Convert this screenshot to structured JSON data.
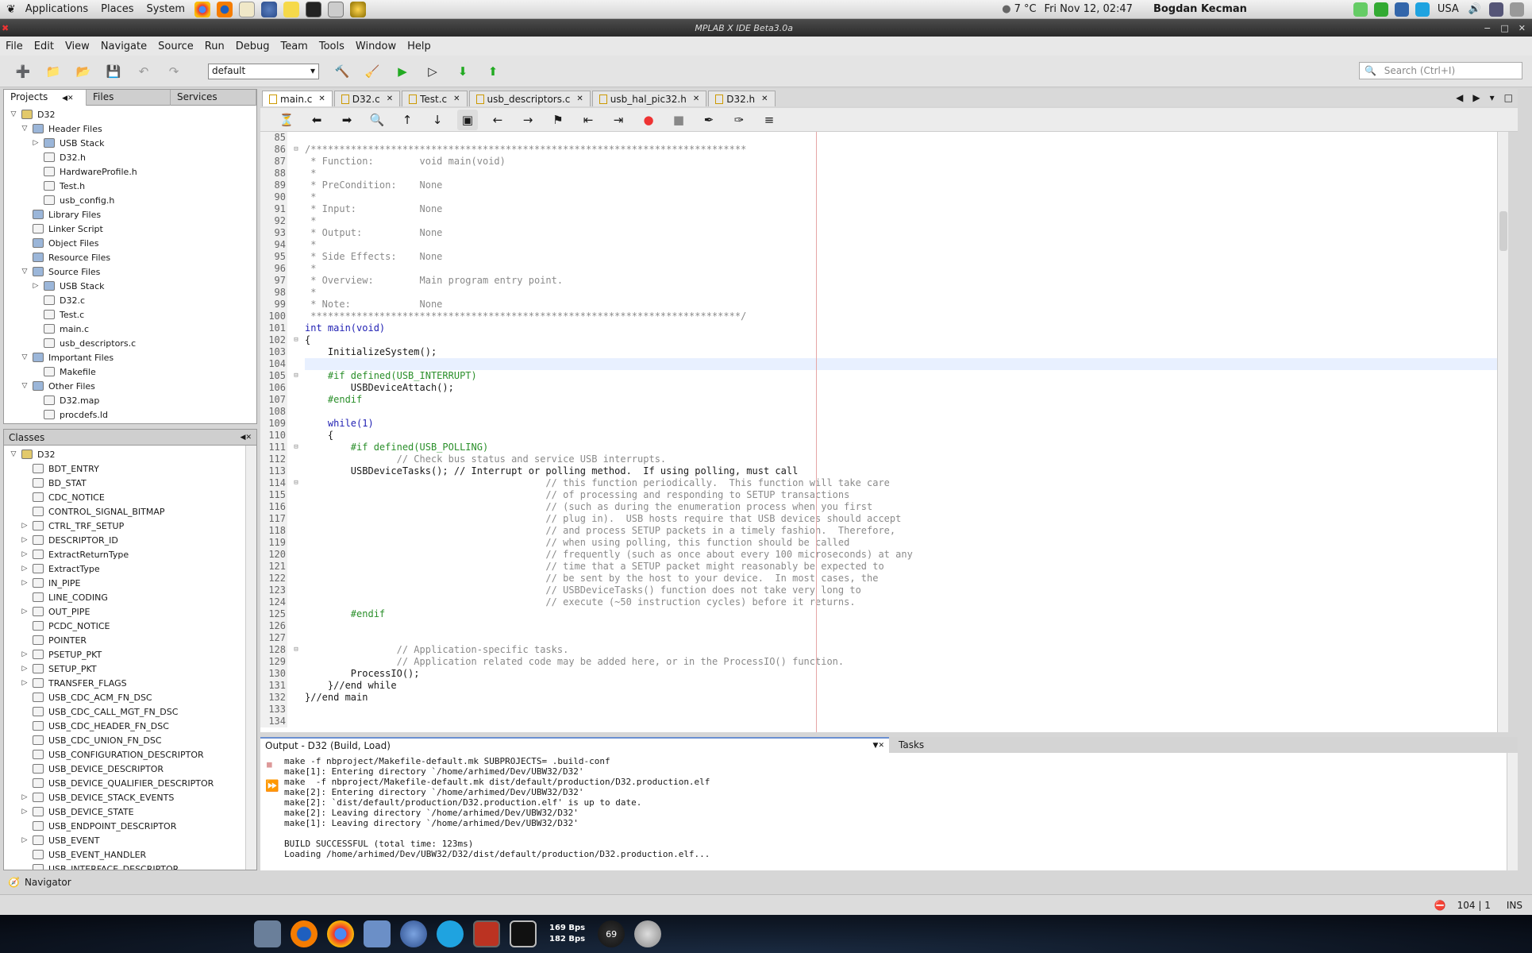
{
  "panel": {
    "menus": [
      "Applications",
      "Places",
      "System"
    ],
    "weather": "7 °C",
    "datetime": "Fri Nov 12, 02:47",
    "user": "Bogdan Kecman",
    "keyboard": "USA"
  },
  "window": {
    "title": "MPLAB X IDE Beta3.0a"
  },
  "menubar": [
    "File",
    "Edit",
    "View",
    "Navigate",
    "Source",
    "Run",
    "Debug",
    "Team",
    "Tools",
    "Window",
    "Help"
  ],
  "toolbar": {
    "config_value": "default",
    "search_placeholder": "Search (Ctrl+I)"
  },
  "projects_panel": {
    "tabs": [
      "Projects",
      "Files",
      "Services"
    ],
    "tree": [
      {
        "label": "D32",
        "depth": 0,
        "toggle": "open"
      },
      {
        "label": "Header Files",
        "depth": 1,
        "toggle": "open"
      },
      {
        "label": "USB Stack",
        "depth": 2,
        "toggle": "closed"
      },
      {
        "label": "D32.h",
        "depth": 2,
        "toggle": ""
      },
      {
        "label": "HardwareProfile.h",
        "depth": 2,
        "toggle": ""
      },
      {
        "label": "Test.h",
        "depth": 2,
        "toggle": ""
      },
      {
        "label": "usb_config.h",
        "depth": 2,
        "toggle": ""
      },
      {
        "label": "Library Files",
        "depth": 1,
        "toggle": ""
      },
      {
        "label": "Linker Script",
        "depth": 1,
        "toggle": ""
      },
      {
        "label": "Object Files",
        "depth": 1,
        "toggle": ""
      },
      {
        "label": "Resource Files",
        "depth": 1,
        "toggle": ""
      },
      {
        "label": "Source Files",
        "depth": 1,
        "toggle": "open"
      },
      {
        "label": "USB Stack",
        "depth": 2,
        "toggle": "closed"
      },
      {
        "label": "D32.c",
        "depth": 2,
        "toggle": ""
      },
      {
        "label": "Test.c",
        "depth": 2,
        "toggle": ""
      },
      {
        "label": "main.c",
        "depth": 2,
        "toggle": ""
      },
      {
        "label": "usb_descriptors.c",
        "depth": 2,
        "toggle": ""
      },
      {
        "label": "Important Files",
        "depth": 1,
        "toggle": "open"
      },
      {
        "label": "Makefile",
        "depth": 2,
        "toggle": ""
      },
      {
        "label": "Other Files",
        "depth": 1,
        "toggle": "open"
      },
      {
        "label": "D32.map",
        "depth": 2,
        "toggle": ""
      },
      {
        "label": "procdefs.ld",
        "depth": 2,
        "toggle": ""
      }
    ]
  },
  "classes_panel": {
    "title": "Classes",
    "tree": [
      {
        "label": "D32",
        "depth": 0,
        "toggle": "open"
      },
      {
        "label": "BDT_ENTRY",
        "depth": 1,
        "toggle": ""
      },
      {
        "label": "BD_STAT",
        "depth": 1,
        "toggle": ""
      },
      {
        "label": "CDC_NOTICE",
        "depth": 1,
        "toggle": ""
      },
      {
        "label": "CONTROL_SIGNAL_BITMAP",
        "depth": 1,
        "toggle": ""
      },
      {
        "label": "CTRL_TRF_SETUP",
        "depth": 1,
        "toggle": "closed"
      },
      {
        "label": "DESCRIPTOR_ID",
        "depth": 1,
        "toggle": "closed"
      },
      {
        "label": "ExtractReturnType",
        "depth": 1,
        "toggle": "closed"
      },
      {
        "label": "ExtractType",
        "depth": 1,
        "toggle": "closed"
      },
      {
        "label": "IN_PIPE",
        "depth": 1,
        "toggle": "closed"
      },
      {
        "label": "LINE_CODING",
        "depth": 1,
        "toggle": ""
      },
      {
        "label": "OUT_PIPE",
        "depth": 1,
        "toggle": "closed"
      },
      {
        "label": "PCDC_NOTICE",
        "depth": 1,
        "toggle": ""
      },
      {
        "label": "POINTER",
        "depth": 1,
        "toggle": ""
      },
      {
        "label": "PSETUP_PKT",
        "depth": 1,
        "toggle": "closed"
      },
      {
        "label": "SETUP_PKT",
        "depth": 1,
        "toggle": "closed"
      },
      {
        "label": "TRANSFER_FLAGS",
        "depth": 1,
        "toggle": "closed"
      },
      {
        "label": "USB_CDC_ACM_FN_DSC",
        "depth": 1,
        "toggle": ""
      },
      {
        "label": "USB_CDC_CALL_MGT_FN_DSC",
        "depth": 1,
        "toggle": ""
      },
      {
        "label": "USB_CDC_HEADER_FN_DSC",
        "depth": 1,
        "toggle": ""
      },
      {
        "label": "USB_CDC_UNION_FN_DSC",
        "depth": 1,
        "toggle": ""
      },
      {
        "label": "USB_CONFIGURATION_DESCRIPTOR",
        "depth": 1,
        "toggle": ""
      },
      {
        "label": "USB_DEVICE_DESCRIPTOR",
        "depth": 1,
        "toggle": ""
      },
      {
        "label": "USB_DEVICE_QUALIFIER_DESCRIPTOR",
        "depth": 1,
        "toggle": ""
      },
      {
        "label": "USB_DEVICE_STACK_EVENTS",
        "depth": 1,
        "toggle": "closed"
      },
      {
        "label": "USB_DEVICE_STATE",
        "depth": 1,
        "toggle": "closed"
      },
      {
        "label": "USB_ENDPOINT_DESCRIPTOR",
        "depth": 1,
        "toggle": ""
      },
      {
        "label": "USB_EVENT",
        "depth": 1,
        "toggle": "closed"
      },
      {
        "label": "USB_EVENT_HANDLER",
        "depth": 1,
        "toggle": ""
      },
      {
        "label": "USB_INTERFACE_DESCRIPTOR",
        "depth": 1,
        "toggle": ""
      }
    ]
  },
  "navigator": {
    "label": "Navigator"
  },
  "editor": {
    "tabs": [
      "main.c",
      "D32.c",
      "Test.c",
      "usb_descriptors.c",
      "usb_hal_pic32.h",
      "D32.h"
    ],
    "active_tab": "main.c",
    "first_line": 85,
    "lines": [
      {
        "t": "",
        "c": ""
      },
      {
        "t": "/****************************************************************************",
        "c": "cm"
      },
      {
        "t": " * Function:        void main(void)",
        "c": "cm"
      },
      {
        "t": " *",
        "c": "cm"
      },
      {
        "t": " * PreCondition:    None",
        "c": "cm"
      },
      {
        "t": " *",
        "c": "cm"
      },
      {
        "t": " * Input:           None",
        "c": "cm"
      },
      {
        "t": " *",
        "c": "cm"
      },
      {
        "t": " * Output:          None",
        "c": "cm"
      },
      {
        "t": " *",
        "c": "cm"
      },
      {
        "t": " * Side Effects:    None",
        "c": "cm"
      },
      {
        "t": " *",
        "c": "cm"
      },
      {
        "t": " * Overview:        Main program entry point.",
        "c": "cm"
      },
      {
        "t": " *",
        "c": "cm"
      },
      {
        "t": " * Note:            None",
        "c": "cm"
      },
      {
        "t": " ***************************************************************************/",
        "c": "cm"
      },
      {
        "t": "int main(void)",
        "c": "kw"
      },
      {
        "t": "{",
        "c": ""
      },
      {
        "t": "    InitializeSystem();",
        "c": ""
      },
      {
        "t": "",
        "c": "cur"
      },
      {
        "t": "    #if defined(USB_INTERRUPT)",
        "c": "pp"
      },
      {
        "t": "        USBDeviceAttach();",
        "c": ""
      },
      {
        "t": "    #endif",
        "c": "pp"
      },
      {
        "t": "",
        "c": ""
      },
      {
        "t": "    while(1)",
        "c": "kw"
      },
      {
        "t": "    {",
        "c": ""
      },
      {
        "t": "        #if defined(USB_POLLING)",
        "c": "pp"
      },
      {
        "t": "                // Check bus status and service USB interrupts.",
        "c": "cm"
      },
      {
        "t": "        USBDeviceTasks(); // Interrupt or polling method.  If using polling, must call",
        "c": "mix"
      },
      {
        "t": "                                          // this function periodically.  This function will take care",
        "c": "cm"
      },
      {
        "t": "                                          // of processing and responding to SETUP transactions",
        "c": "cm"
      },
      {
        "t": "                                          // (such as during the enumeration process when you first",
        "c": "cm"
      },
      {
        "t": "                                          // plug in).  USB hosts require that USB devices should accept",
        "c": "cm"
      },
      {
        "t": "                                          // and process SETUP packets in a timely fashion.  Therefore,",
        "c": "cm"
      },
      {
        "t": "                                          // when using polling, this function should be called",
        "c": "cm"
      },
      {
        "t": "                                          // frequently (such as once about every 100 microseconds) at any",
        "c": "cm"
      },
      {
        "t": "                                          // time that a SETUP packet might reasonably be expected to",
        "c": "cm"
      },
      {
        "t": "                                          // be sent by the host to your device.  In most cases, the",
        "c": "cm"
      },
      {
        "t": "                                          // USBDeviceTasks() function does not take very long to",
        "c": "cm"
      },
      {
        "t": "                                          // execute (~50 instruction cycles) before it returns.",
        "c": "cm"
      },
      {
        "t": "        #endif",
        "c": "pp"
      },
      {
        "t": "",
        "c": ""
      },
      {
        "t": "",
        "c": ""
      },
      {
        "t": "                // Application-specific tasks.",
        "c": "cm"
      },
      {
        "t": "                // Application related code may be added here, or in the ProcessIO() function.",
        "c": "cm"
      },
      {
        "t": "        ProcessIO();",
        "c": ""
      },
      {
        "t": "    }//end while",
        "c": "mix2"
      },
      {
        "t": "}//end main",
        "c": "mix2"
      },
      {
        "t": "",
        "c": ""
      },
      {
        "t": "",
        "c": ""
      }
    ]
  },
  "output": {
    "title": "Output - D32 (Build, Load)",
    "tasks_tab": "Tasks",
    "lines": [
      "make -f nbproject/Makefile-default.mk SUBPROJECTS= .build-conf",
      "make[1]: Entering directory `/home/arhimed/Dev/UBW32/D32'",
      "make  -f nbproject/Makefile-default.mk dist/default/production/D32.production.elf",
      "make[2]: Entering directory `/home/arhimed/Dev/UBW32/D32'",
      "make[2]: `dist/default/production/D32.production.elf' is up to date.",
      "make[2]: Leaving directory `/home/arhimed/Dev/UBW32/D32'",
      "make[1]: Leaving directory `/home/arhimed/Dev/UBW32/D32'",
      "",
      "BUILD SUCCESSFUL (total time: 123ms)",
      "Loading /home/arhimed/Dev/UBW32/D32/dist/default/production/D32.production.elf..."
    ]
  },
  "statusbar": {
    "position": "104 | 1",
    "mode": "INS"
  },
  "taskbar": {
    "net_up": "169 Bps",
    "net_down": "182 Bps",
    "temp": "69"
  }
}
